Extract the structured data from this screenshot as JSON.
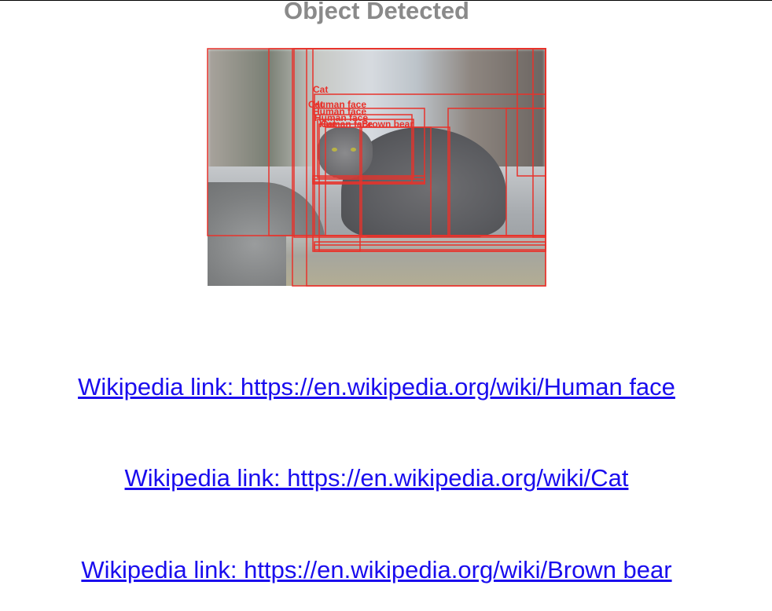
{
  "title": "Object Detected",
  "detections": [
    {
      "label": "Cat"
    },
    {
      "label": "Cat"
    },
    {
      "label": "Human face"
    },
    {
      "label": "Human face"
    },
    {
      "label": "Human face"
    },
    {
      "label": "Human face"
    },
    {
      "label": "Cat"
    },
    {
      "label": "Brown bear"
    }
  ],
  "box_color": "#e8322b",
  "links": [
    {
      "text": "Wikipedia link: https://en.wikipedia.org/wiki/Human face"
    },
    {
      "text": "Wikipedia link: https://en.wikipedia.org/wiki/Cat"
    },
    {
      "text": "Wikipedia link: https://en.wikipedia.org/wiki/Brown bear"
    }
  ],
  "link_color": "#1a0dee"
}
